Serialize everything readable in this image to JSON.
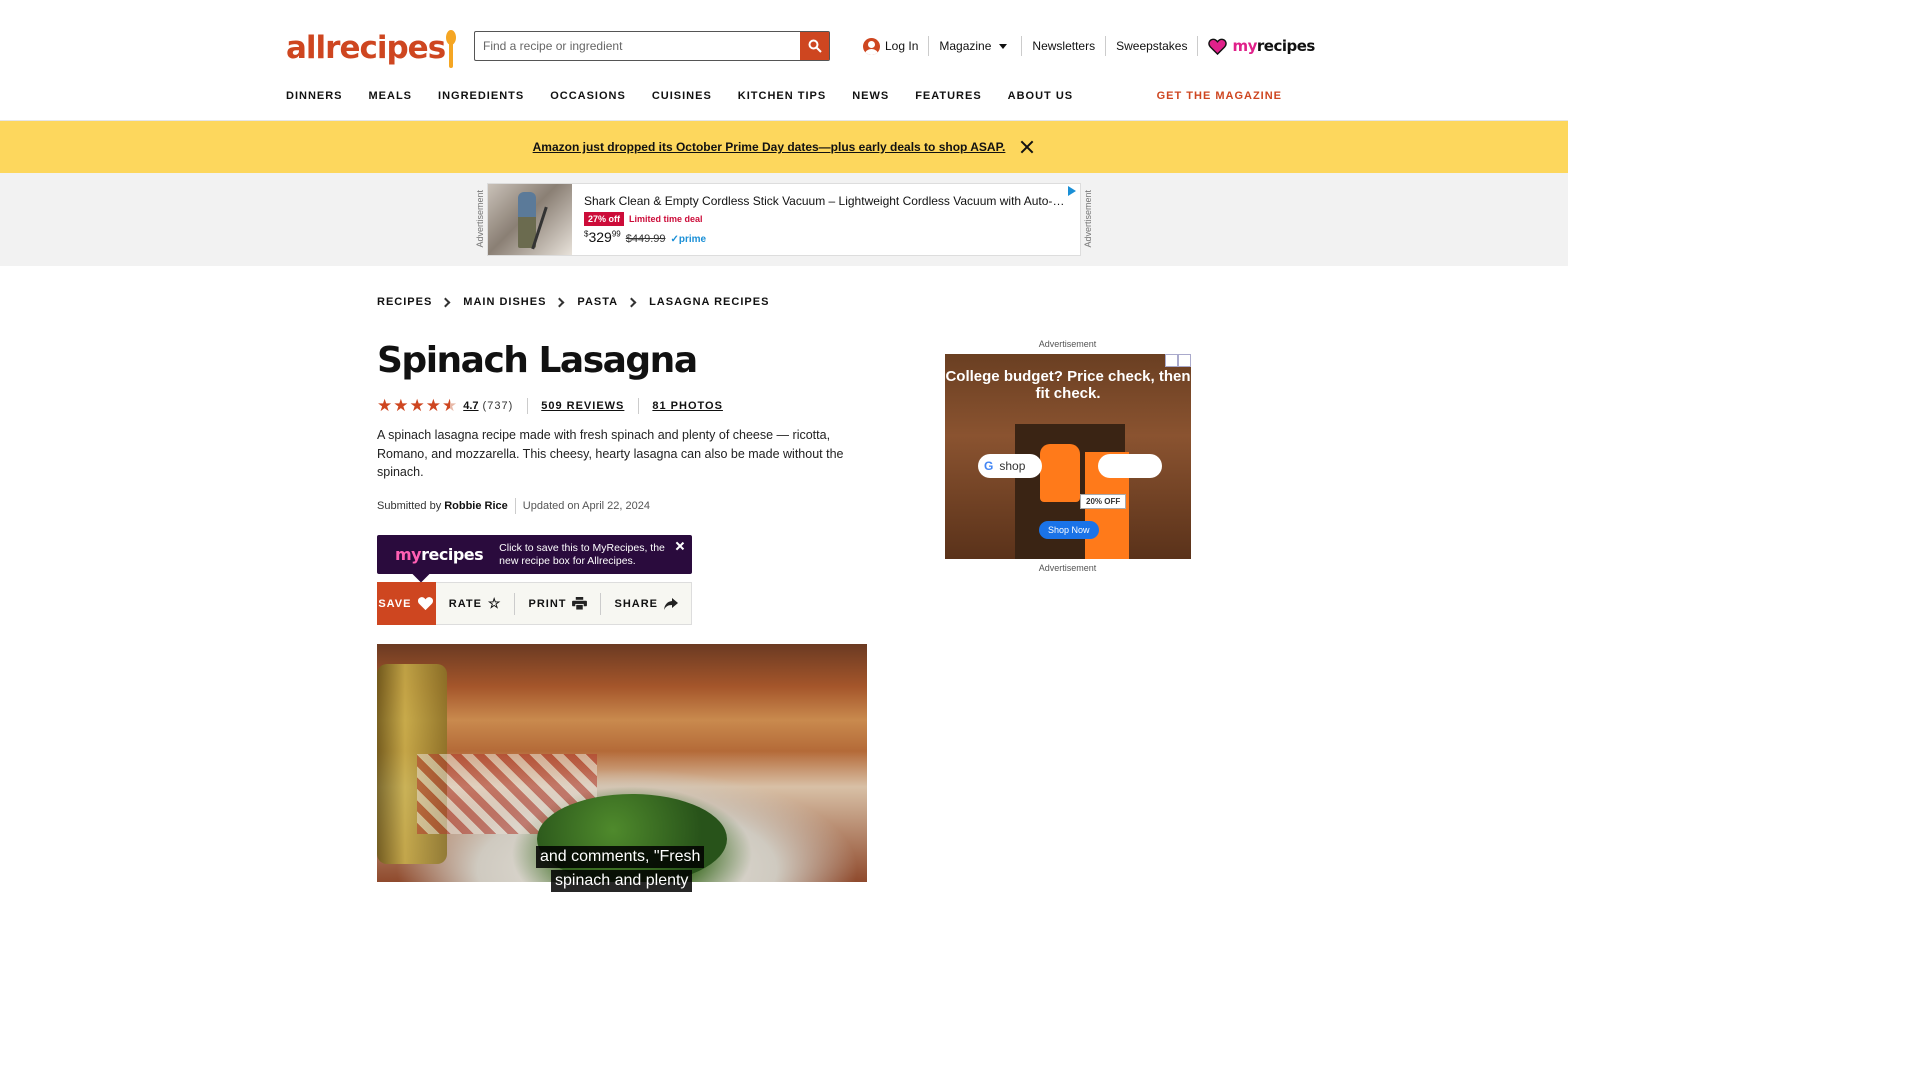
{
  "header": {
    "logo_text": "allrecipes",
    "search_placeholder": "Find a recipe or ingredient",
    "utility": {
      "login": "Log In",
      "magazine": "Magazine",
      "newsletters": "Newsletters",
      "sweepstakes": "Sweepstakes",
      "myrecipes_my": "my",
      "myrecipes_rest": "recipes"
    },
    "nav": [
      "DINNERS",
      "MEALS",
      "INGREDIENTS",
      "OCCASIONS",
      "CUISINES",
      "KITCHEN TIPS",
      "NEWS",
      "FEATURES",
      "ABOUT US"
    ],
    "get_magazine": "GET THE MAGAZINE"
  },
  "banner": {
    "text": "Amazon just dropped its October Prime Day dates—plus early deals to shop ASAP."
  },
  "top_ad": {
    "label": "Advertisement",
    "title": "Shark Clean & Empty Cordless Stick Vacuum – Lightweight Cordless Vacuum with Auto-Em…",
    "badge": "27% off",
    "deal": "Limited time deal",
    "price_dollar": "$",
    "price_whole": "329",
    "price_cents": "99",
    "old_price": "$449.99",
    "prime": "✓prime"
  },
  "breadcrumb": [
    "RECIPES",
    "MAIN DISHES",
    "PASTA",
    "LASAGNA RECIPES"
  ],
  "recipe": {
    "title": "Spinach Lasagna",
    "rating": "4.7",
    "rating_count": "(737)",
    "reviews": "509 REVIEWS",
    "photos": "81 PHOTOS",
    "description": "A spinach lasagna recipe made with fresh spinach and plenty of cheese — ricotta, Romano, and mozzarella. This cheesy, hearty lasagna can also be made without the spinach.",
    "submitted_by_label": "Submitted by",
    "author": "Robbie Rice",
    "updated": "Updated on April 22, 2024"
  },
  "myrecipes_promo": {
    "logo_my": "my",
    "logo_rest": "recipes",
    "message": "Click to save this to MyRecipes, the new recipe box for Allrecipes."
  },
  "actions": {
    "save": "SAVE",
    "rate": "RATE",
    "print": "PRINT",
    "share": "SHARE"
  },
  "video": {
    "caption_line1": "and comments, \"Fresh",
    "caption_line2": "spinach and plenty"
  },
  "side_ad": {
    "label_top": "Advertisement",
    "label_bottom": "Advertisement",
    "headline": "College budget? Price check, then fit check.",
    "search_text": "shop",
    "discount": "20% OFF",
    "cta": "Shop Now"
  },
  "colors": {
    "brand": "#ce4620",
    "banner": "#fdd75d",
    "myrecipes_pink": "#e0218a",
    "promo_bg": "#2a0b3d"
  }
}
